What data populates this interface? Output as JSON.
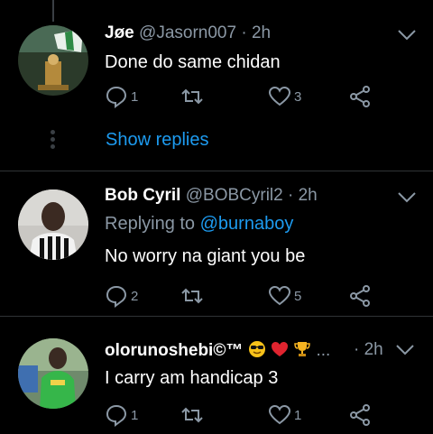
{
  "tweets": [
    {
      "name": "Jøe",
      "handle": "@Jasorn007",
      "time": "· 2h",
      "text": "Done do same chidan",
      "reply_count": "1",
      "like_count": "3",
      "show_replies": "Show replies"
    },
    {
      "name": "Bob Cyril",
      "handle": "@BOBCyril2",
      "time": "· 2h",
      "replying_prefix": "Replying to",
      "replying_handle": "@burnaboy",
      "text": "No worry na giant you be",
      "reply_count": "2",
      "like_count": "5"
    },
    {
      "name": "olorunoshebi©™",
      "ellipsis": "...",
      "time": "· 2h",
      "text": "I carry am handicap 3",
      "reply_count": "1",
      "like_count": "1"
    }
  ],
  "icons": {
    "reply": "reply-icon",
    "retweet": "retweet-icon",
    "like": "heart-icon",
    "share": "share-icon",
    "menu": "chevron-down-icon"
  },
  "colors": {
    "background": "#000000",
    "text": "#ffffff",
    "muted": "#8b98a5",
    "accent": "#1d9bf0",
    "divider": "#2f3336"
  }
}
